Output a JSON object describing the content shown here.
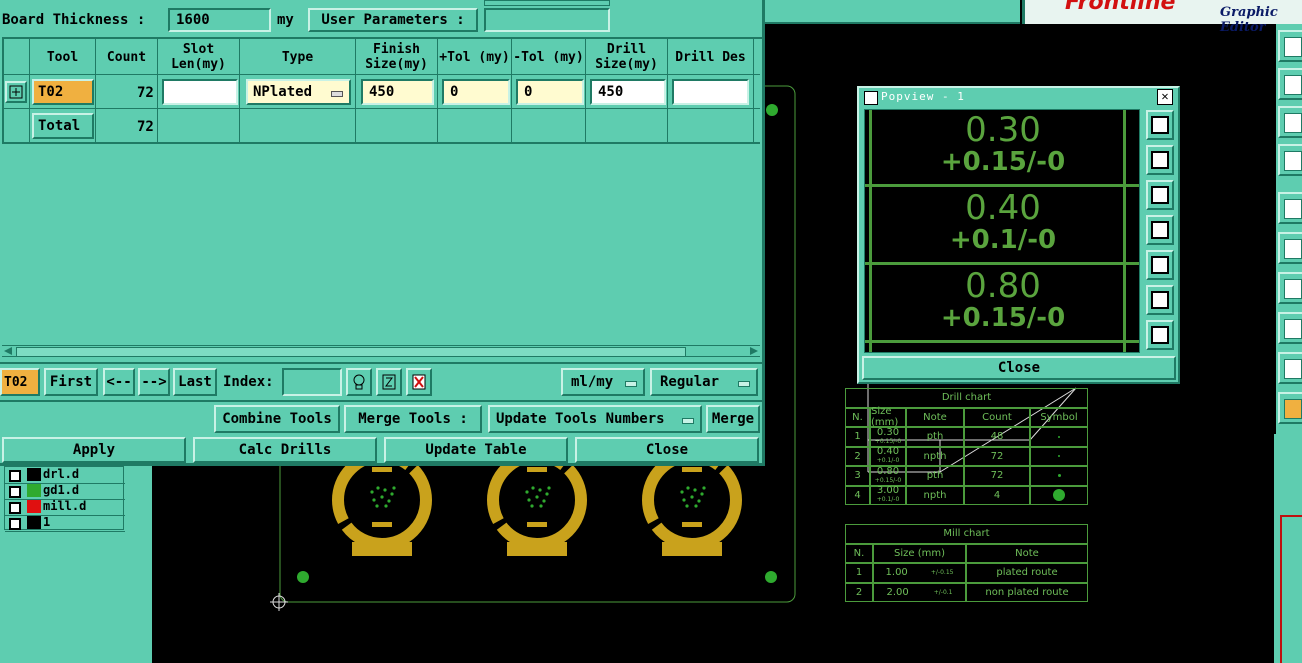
{
  "colors": {
    "accent": "#f0b040",
    "panel": "#5ecdb0",
    "pcb_green": "#4b9b3c",
    "pad_gold": "#c9a21c"
  },
  "brand": {
    "logo": "Frontline",
    "app": "Graphic Editor"
  },
  "drill": {
    "board_thickness_label": "Board Thickness :",
    "board_thickness_value": "1600",
    "board_thickness_unit": "my",
    "user_params_label": "User Parameters :",
    "user_params_value": "",
    "columns": [
      "Tool",
      "Count",
      "Slot Len(my)",
      "Type",
      "Finish Size(my)",
      "+Tol (my)",
      "-Tol (my)",
      "Drill Size(my)",
      "Drill Des"
    ],
    "row": {
      "tool": "T02",
      "count": "72",
      "slot_len": "",
      "type": "NPlated",
      "finish": "450",
      "ptol": "0",
      "mtol": "0",
      "drill_size": "450",
      "drill_des": ""
    },
    "total": {
      "label": "Total",
      "count": "72"
    },
    "nav": {
      "current": "T02",
      "first": "First",
      "prev": "<--",
      "next": "-->",
      "last": "Last",
      "index_label": "Index:",
      "index_value": "",
      "unit": "ml/my",
      "mode": "Regular"
    },
    "actions": {
      "combine": "Combine Tools",
      "merge_label": "Merge Tools :",
      "update_numbers": "Update Tools Numbers",
      "merge": "Merge",
      "apply": "Apply",
      "calc": "Calc Drills",
      "update_table": "Update Table",
      "close": "Close"
    }
  },
  "popview": {
    "title": "Popview - 1",
    "entries": [
      {
        "size": "0.30",
        "tol": "+0.15/-0"
      },
      {
        "size": "0.40",
        "tol": "+0.1/-0"
      },
      {
        "size": "0.80",
        "tol": "+0.15/-0"
      }
    ],
    "close": "Close"
  },
  "layers": [
    {
      "name": "drl.d",
      "color": "#000000"
    },
    {
      "name": "gd1.d",
      "color": "#2faa2f"
    },
    {
      "name": "mill.d",
      "color": "#e01010"
    },
    {
      "name": "1",
      "color": "#000000"
    }
  ],
  "drill_chart": {
    "title": "Drill chart",
    "headers": [
      "N.",
      "Size (mm)",
      "Note",
      "Count",
      "Symbol"
    ],
    "rows": [
      {
        "n": "1",
        "size": "0.30",
        "tol": "+0.15/-0",
        "note": "pth",
        "count": "48"
      },
      {
        "n": "2",
        "size": "0.40",
        "tol": "+0.1/-0",
        "note": "npth",
        "count": "72"
      },
      {
        "n": "3",
        "size": "0.80",
        "tol": "+0.15/-0",
        "note": "pth",
        "count": "72"
      },
      {
        "n": "4",
        "size": "3.00",
        "tol": "+0.1/-0",
        "note": "npth",
        "count": "4"
      }
    ]
  },
  "mill_chart": {
    "title": "Mill chart",
    "headers": [
      "N.",
      "Size (mm)",
      "Note"
    ],
    "rows": [
      {
        "n": "1",
        "size": "1.00",
        "tol": "+/-0.15",
        "note": "plated route"
      },
      {
        "n": "2",
        "size": "2.00",
        "tol": "+/-0.1",
        "note": "non plated route"
      }
    ]
  }
}
